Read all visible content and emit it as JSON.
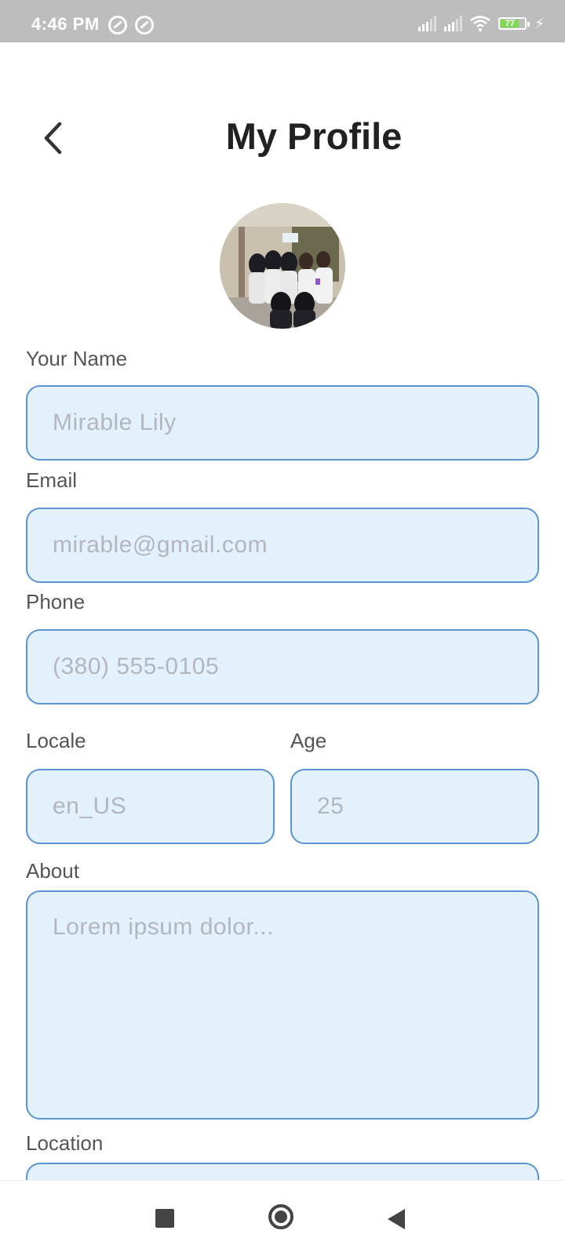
{
  "status_bar": {
    "time": "4:46 PM",
    "battery_level": "77",
    "battery_percent": 77,
    "icons": [
      "notification-icon",
      "notification-icon",
      "signal-icon",
      "signal-icon",
      "wifi-icon",
      "battery-icon",
      "charging-icon"
    ]
  },
  "header": {
    "title": "My Profile",
    "back_icon": "chevron-left-icon"
  },
  "avatar": {
    "icon": "profile-photo"
  },
  "form": {
    "name": {
      "label": "Your Name",
      "placeholder": "Mirable Lily"
    },
    "email": {
      "label": "Email",
      "placeholder": "mirable@gmail.com"
    },
    "phone": {
      "label": "Phone",
      "placeholder": "(380) 555-0105"
    },
    "locale": {
      "label": "Locale",
      "placeholder": "en_US"
    },
    "age": {
      "label": "Age",
      "placeholder": "25"
    },
    "about": {
      "label": "About",
      "placeholder": "Lorem ipsum dolor..."
    },
    "location": {
      "label": "Location",
      "placeholder": ""
    }
  },
  "nav_bar": {
    "icons": [
      "recents-icon",
      "home-icon",
      "back-icon"
    ]
  },
  "colors": {
    "field_background": "#e3f1fd",
    "field_border": "#5b93d3",
    "status_bar": "#bdbdbd",
    "battery": "#7ed957"
  }
}
